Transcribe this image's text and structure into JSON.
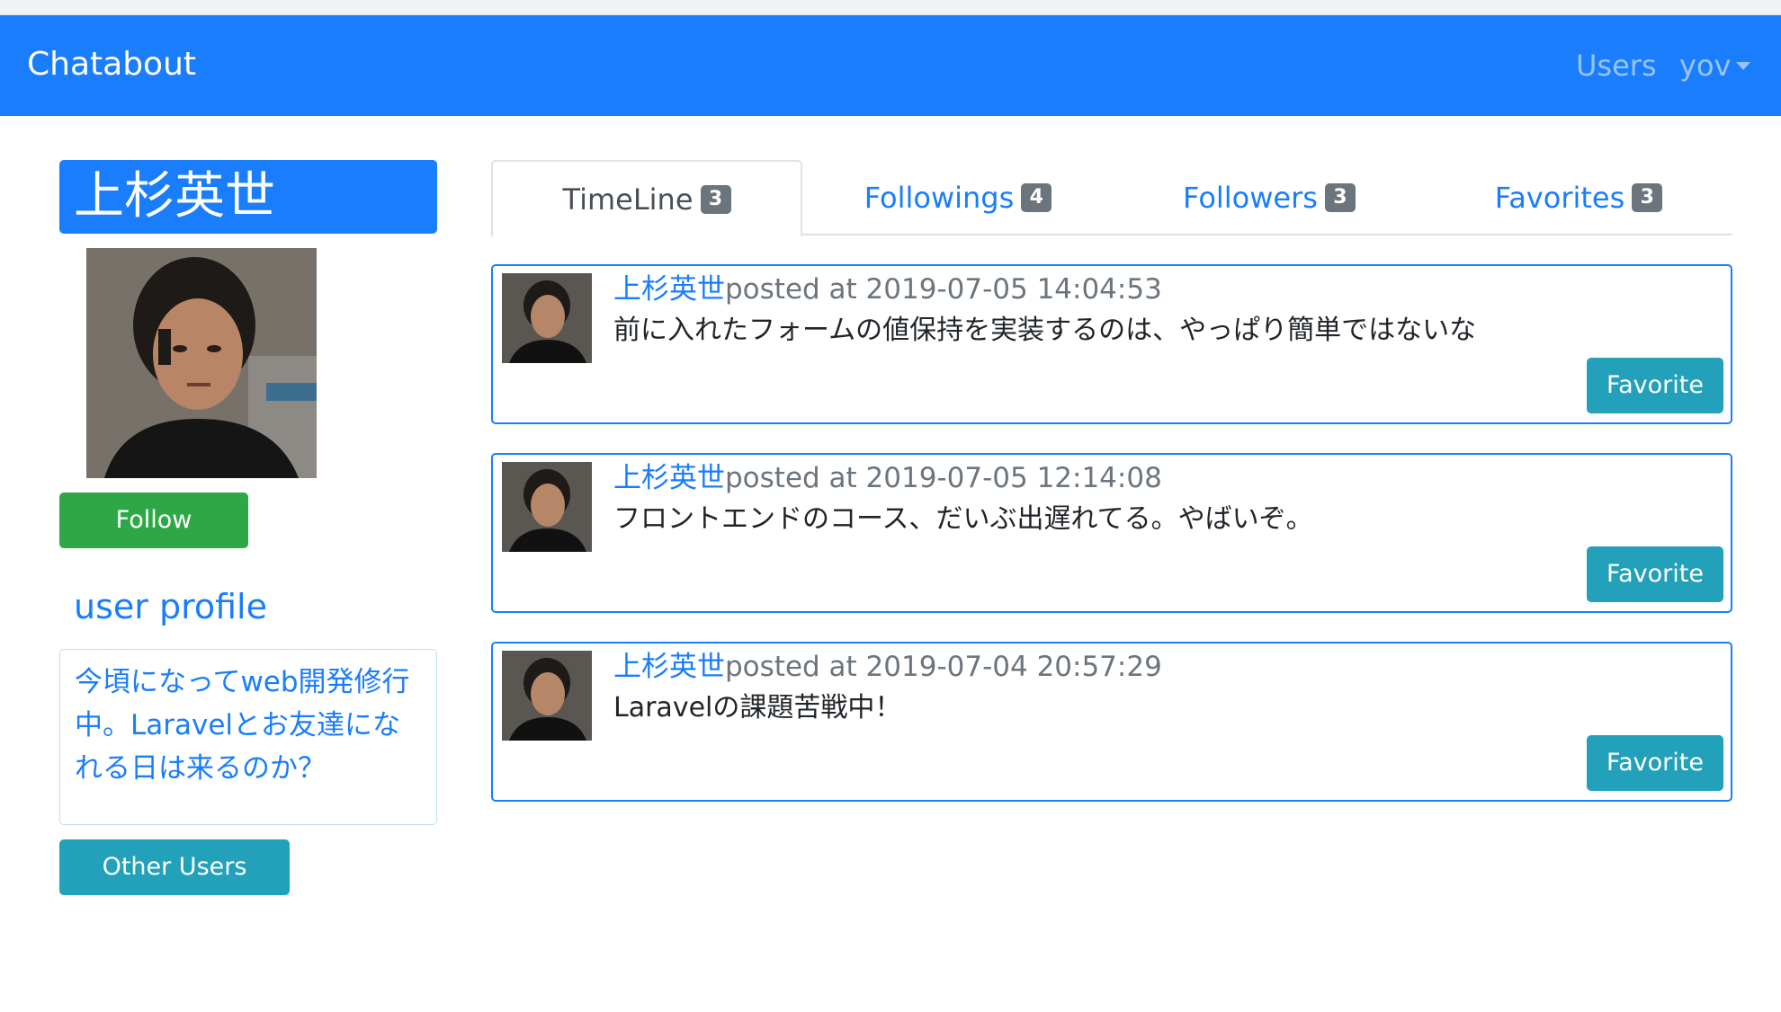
{
  "navbar": {
    "brand": "Chatabout",
    "users_link": "Users",
    "user_menu": "yov"
  },
  "profile": {
    "name": "上杉英世",
    "follow_label": "Follow",
    "heading": "user profile",
    "bio": "今頃になってweb開発修行中。Laravelとお友達になれる日は来るのか？",
    "other_users_label": "Other Users"
  },
  "tabs": [
    {
      "label": "TimeLine",
      "count": "3",
      "active": true
    },
    {
      "label": "Followings",
      "count": "4",
      "active": false
    },
    {
      "label": "Followers",
      "count": "3",
      "active": false
    },
    {
      "label": "Favorites",
      "count": "3",
      "active": false
    }
  ],
  "posts": [
    {
      "author": "上杉英世",
      "posted": "posted at 2019-07-05 14:04:53",
      "content": "前に入れたフォームの値保持を実装するのは、やっぱり簡単ではないな",
      "button": "Favorite"
    },
    {
      "author": "上杉英世",
      "posted": "posted at 2019-07-05 12:14:08",
      "content": "フロントエンドのコース、だいぶ出遅れてる。やばいぞ。",
      "button": "Favorite"
    },
    {
      "author": "上杉英世",
      "posted": "posted at 2019-07-04 20:57:29",
      "content": "Laravelの課題苦戦中！",
      "button": "Favorite"
    }
  ],
  "colors": {
    "primary": "#1a7dfc",
    "success": "#2ea847",
    "info": "#23a1ba",
    "badge": "#6c757d"
  }
}
